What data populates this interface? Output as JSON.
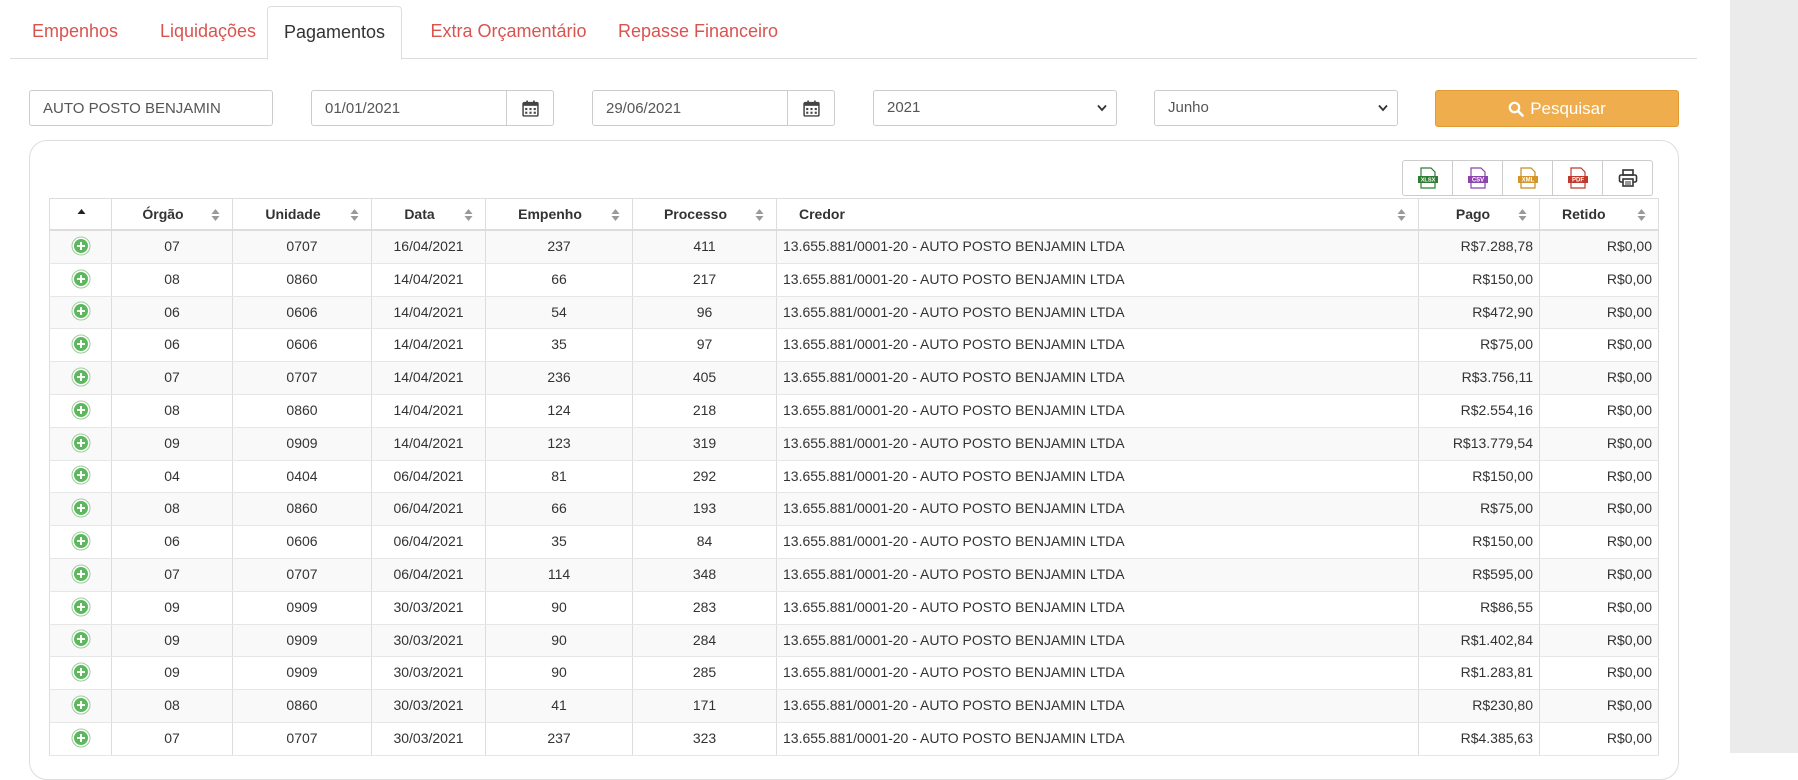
{
  "tabs": [
    {
      "label": "Empenhos",
      "active": false
    },
    {
      "label": "Liquidações",
      "active": false
    },
    {
      "label": "Pagamentos",
      "active": true
    },
    {
      "label": "Extra Orçamentário",
      "active": false
    },
    {
      "label": "Repasse Financeiro",
      "active": false
    }
  ],
  "filters": {
    "credor": "AUTO POSTO BENJAMIN",
    "data_inicio": "01/01/2021",
    "data_fim": "29/06/2021",
    "ano": "2021",
    "mes": "Junho",
    "search_label": "Pesquisar"
  },
  "export_buttons": [
    "xlsx-icon",
    "csv-icon",
    "xml-icon",
    "pdf-icon",
    "print-icon"
  ],
  "export_labels": {
    "xlsx": "XLSX",
    "csv": "CSV",
    "xml": "XML",
    "pdf": "PDF"
  },
  "colors": {
    "accent": "#f0ad4e",
    "tab_link": "#d9534f",
    "expand_green": "#5cb85c"
  },
  "table": {
    "columns": [
      "",
      "Órgão",
      "Unidade",
      "Data",
      "Empenho",
      "Processo",
      "Credor",
      "Pago",
      "Retido"
    ],
    "rows": [
      [
        "07",
        "0707",
        "16/04/2021",
        "237",
        "411",
        "13.655.881/0001-20 - AUTO POSTO BENJAMIN LTDA",
        "R$7.288,78",
        "R$0,00"
      ],
      [
        "08",
        "0860",
        "14/04/2021",
        "66",
        "217",
        "13.655.881/0001-20 - AUTO POSTO BENJAMIN LTDA",
        "R$150,00",
        "R$0,00"
      ],
      [
        "06",
        "0606",
        "14/04/2021",
        "54",
        "96",
        "13.655.881/0001-20 - AUTO POSTO BENJAMIN LTDA",
        "R$472,90",
        "R$0,00"
      ],
      [
        "06",
        "0606",
        "14/04/2021",
        "35",
        "97",
        "13.655.881/0001-20 - AUTO POSTO BENJAMIN LTDA",
        "R$75,00",
        "R$0,00"
      ],
      [
        "07",
        "0707",
        "14/04/2021",
        "236",
        "405",
        "13.655.881/0001-20 - AUTO POSTO BENJAMIN LTDA",
        "R$3.756,11",
        "R$0,00"
      ],
      [
        "08",
        "0860",
        "14/04/2021",
        "124",
        "218",
        "13.655.881/0001-20 - AUTO POSTO BENJAMIN LTDA",
        "R$2.554,16",
        "R$0,00"
      ],
      [
        "09",
        "0909",
        "14/04/2021",
        "123",
        "319",
        "13.655.881/0001-20 - AUTO POSTO BENJAMIN LTDA",
        "R$13.779,54",
        "R$0,00"
      ],
      [
        "04",
        "0404",
        "06/04/2021",
        "81",
        "292",
        "13.655.881/0001-20 - AUTO POSTO BENJAMIN LTDA",
        "R$150,00",
        "R$0,00"
      ],
      [
        "08",
        "0860",
        "06/04/2021",
        "66",
        "193",
        "13.655.881/0001-20 - AUTO POSTO BENJAMIN LTDA",
        "R$75,00",
        "R$0,00"
      ],
      [
        "06",
        "0606",
        "06/04/2021",
        "35",
        "84",
        "13.655.881/0001-20 - AUTO POSTO BENJAMIN LTDA",
        "R$150,00",
        "R$0,00"
      ],
      [
        "07",
        "0707",
        "06/04/2021",
        "114",
        "348",
        "13.655.881/0001-20 - AUTO POSTO BENJAMIN LTDA",
        "R$595,00",
        "R$0,00"
      ],
      [
        "09",
        "0909",
        "30/03/2021",
        "90",
        "283",
        "13.655.881/0001-20 - AUTO POSTO BENJAMIN LTDA",
        "R$86,55",
        "R$0,00"
      ],
      [
        "09",
        "0909",
        "30/03/2021",
        "90",
        "284",
        "13.655.881/0001-20 - AUTO POSTO BENJAMIN LTDA",
        "R$1.402,84",
        "R$0,00"
      ],
      [
        "09",
        "0909",
        "30/03/2021",
        "90",
        "285",
        "13.655.881/0001-20 - AUTO POSTO BENJAMIN LTDA",
        "R$1.283,81",
        "R$0,00"
      ],
      [
        "08",
        "0860",
        "30/03/2021",
        "41",
        "171",
        "13.655.881/0001-20 - AUTO POSTO BENJAMIN LTDA",
        "R$230,80",
        "R$0,00"
      ],
      [
        "07",
        "0707",
        "30/03/2021",
        "237",
        "323",
        "13.655.881/0001-20 - AUTO POSTO BENJAMIN LTDA",
        "R$4.385,63",
        "R$0,00"
      ]
    ]
  }
}
